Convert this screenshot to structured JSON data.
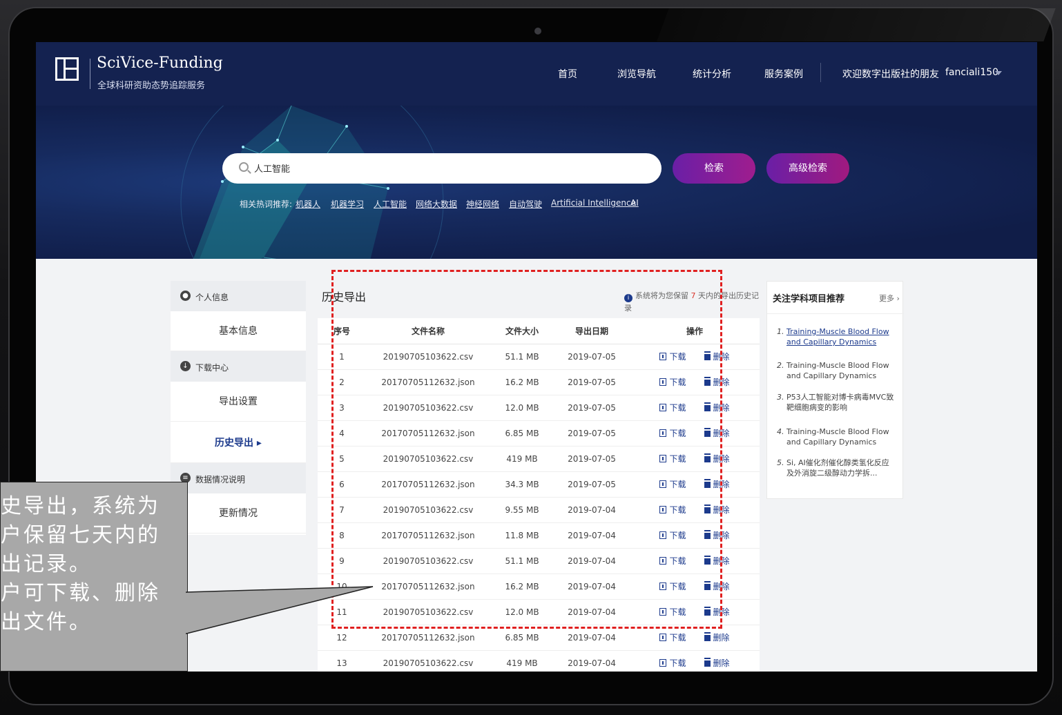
{
  "header": {
    "brand": "SciVice-Funding",
    "brand_sub": "全球科研资助态势追踪服务",
    "nav": [
      "首页",
      "浏览导航",
      "统计分析",
      "服务案例"
    ],
    "welcome": "欢迎数字出版社的朋友",
    "username": "fanciali150"
  },
  "search": {
    "query": "人工智能",
    "search_button": "检索",
    "advanced_button": "高级检索",
    "hot_label": "相关热词推荐:",
    "hot_terms": [
      "机器人",
      "机器学习",
      "人工智能",
      "网络大数据",
      "神经网络",
      "自动驾驶",
      "Artificial Intelligence",
      "AI"
    ]
  },
  "sidebar": {
    "sections": [
      {
        "title": "个人信息",
        "items": [
          "基本信息"
        ]
      },
      {
        "title": "下载中心",
        "items": [
          "导出设置",
          "历史导出"
        ]
      },
      {
        "title": "数据情况说明",
        "items": [
          "更新情况"
        ]
      }
    ],
    "active_item": "历史导出"
  },
  "main": {
    "title": "历史导出",
    "notice_prefix": "系统将为您保留",
    "notice_days": "7",
    "notice_suffix": "天内的导出历史记录",
    "columns": [
      "序号",
      "文件名称",
      "文件大小",
      "导出日期",
      "操作"
    ],
    "download_label": "下载",
    "delete_label": "删除",
    "rows": [
      {
        "no": "1",
        "name": "20190705103622.csv",
        "size": "51.1 MB",
        "date": "2019-07-05"
      },
      {
        "no": "2",
        "name": "20170705112632.json",
        "size": "16.2 MB",
        "date": "2019-07-05"
      },
      {
        "no": "3",
        "name": "20190705103622.csv",
        "size": "12.0 MB",
        "date": "2019-07-05"
      },
      {
        "no": "4",
        "name": "20170705112632.json",
        "size": "6.85 MB",
        "date": "2019-07-05"
      },
      {
        "no": "5",
        "name": "20190705103622.csv",
        "size": "419 MB",
        "date": "2019-07-05"
      },
      {
        "no": "6",
        "name": "20170705112632.json",
        "size": "34.3 MB",
        "date": "2019-07-05"
      },
      {
        "no": "7",
        "name": "20190705103622.csv",
        "size": "9.55 MB",
        "date": "2019-07-04"
      },
      {
        "no": "8",
        "name": "20170705112632.json",
        "size": "11.8 MB",
        "date": "2019-07-04"
      },
      {
        "no": "9",
        "name": "20190705103622.csv",
        "size": "51.1 MB",
        "date": "2019-07-04"
      },
      {
        "no": "10",
        "name": "20170705112632.json",
        "size": "16.2 MB",
        "date": "2019-07-04"
      },
      {
        "no": "11",
        "name": "20190705103622.csv",
        "size": "12.0 MB",
        "date": "2019-07-04"
      },
      {
        "no": "12",
        "name": "20170705112632.json",
        "size": "6.85 MB",
        "date": "2019-07-04"
      },
      {
        "no": "13",
        "name": "20190705103622.csv",
        "size": "419 MB",
        "date": "2019-07-04"
      }
    ]
  },
  "recommend": {
    "title": "关注学科项目推荐",
    "more": "更多",
    "items": [
      {
        "n": "1.",
        "text": "Training-Muscle Blood Flow and Capillary Dynamics"
      },
      {
        "n": "2.",
        "text": "Training-Muscle Blood Flow and Capillary Dynamics"
      },
      {
        "n": "3.",
        "text": "P53人工智能对博卡病毒MVC致靶细胞病变的影响"
      },
      {
        "n": "4.",
        "text": "Training-Muscle Blood Flow and Capillary Dynamics"
      },
      {
        "n": "5.",
        "text": "Si, AI催化剂催化醇类氢化反应及外消旋二级醇动力学拆..."
      }
    ]
  },
  "callout": {
    "lines": [
      "史导出，系统为",
      "户保留七天内的",
      "出记录。",
      "户可下载、删除",
      "出文件。"
    ]
  },
  "colors": {
    "header_bg": "#142250",
    "accent": "#1c3a8c",
    "button_gradient_start": "#6a1fa6",
    "button_gradient_end": "#9f1d8e",
    "highlight": "#e02020",
    "notice_days": "#d9352b"
  }
}
